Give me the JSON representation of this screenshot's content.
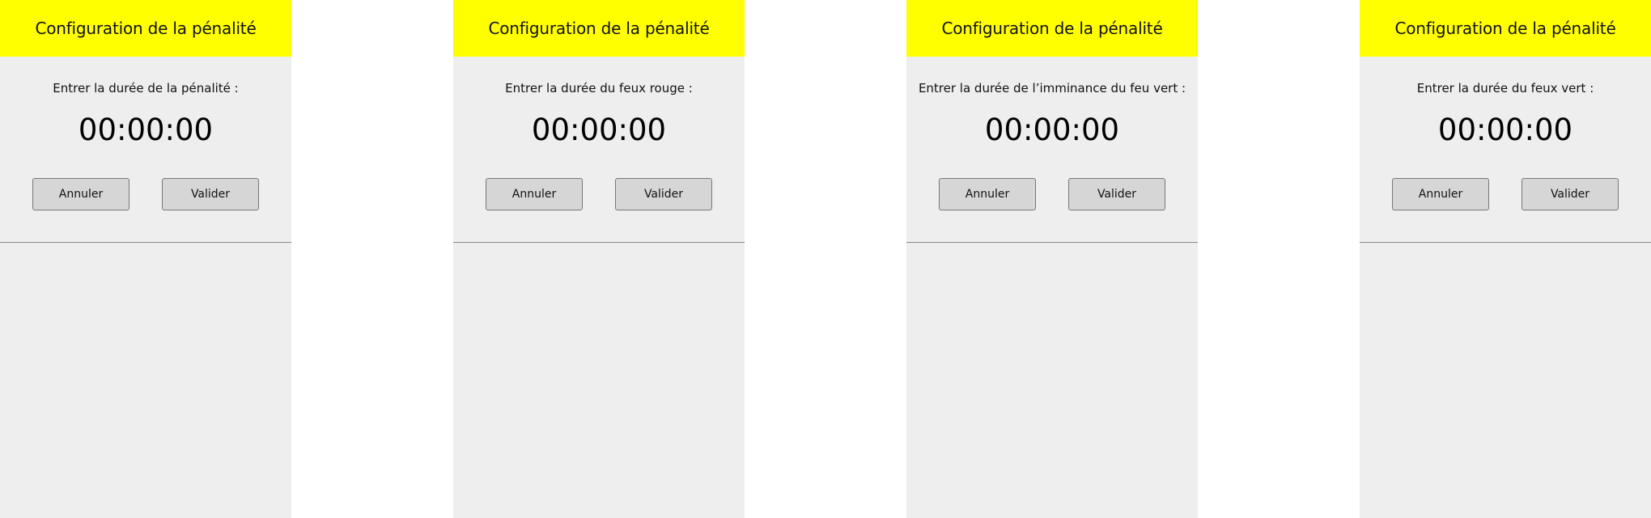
{
  "colors": {
    "header_bg": "#ffff00",
    "screen_bg": "#eeeeee",
    "button_bg": "#d6d6d6"
  },
  "screens": [
    {
      "title": "Configuration de la pénalité",
      "prompt": "Entrer la durée de la pénalité :",
      "time": "00:00:00",
      "cancel_label": "Annuler",
      "validate_label": "Valider"
    },
    {
      "title": "Configuration de la pénalité",
      "prompt": "Entrer la durée du feux rouge :",
      "time": "00:00:00",
      "cancel_label": "Annuler",
      "validate_label": "Valider"
    },
    {
      "title": "Configuration de la pénalité",
      "prompt": "Entrer la durée de l’imminance du feu vert :",
      "time": "00:00:00",
      "cancel_label": "Annuler",
      "validate_label": "Valider"
    },
    {
      "title": "Configuration de la pénalité",
      "prompt": "Entrer la durée du feux vert :",
      "time": "00:00:00",
      "cancel_label": "Annuler",
      "validate_label": "Valider"
    }
  ]
}
